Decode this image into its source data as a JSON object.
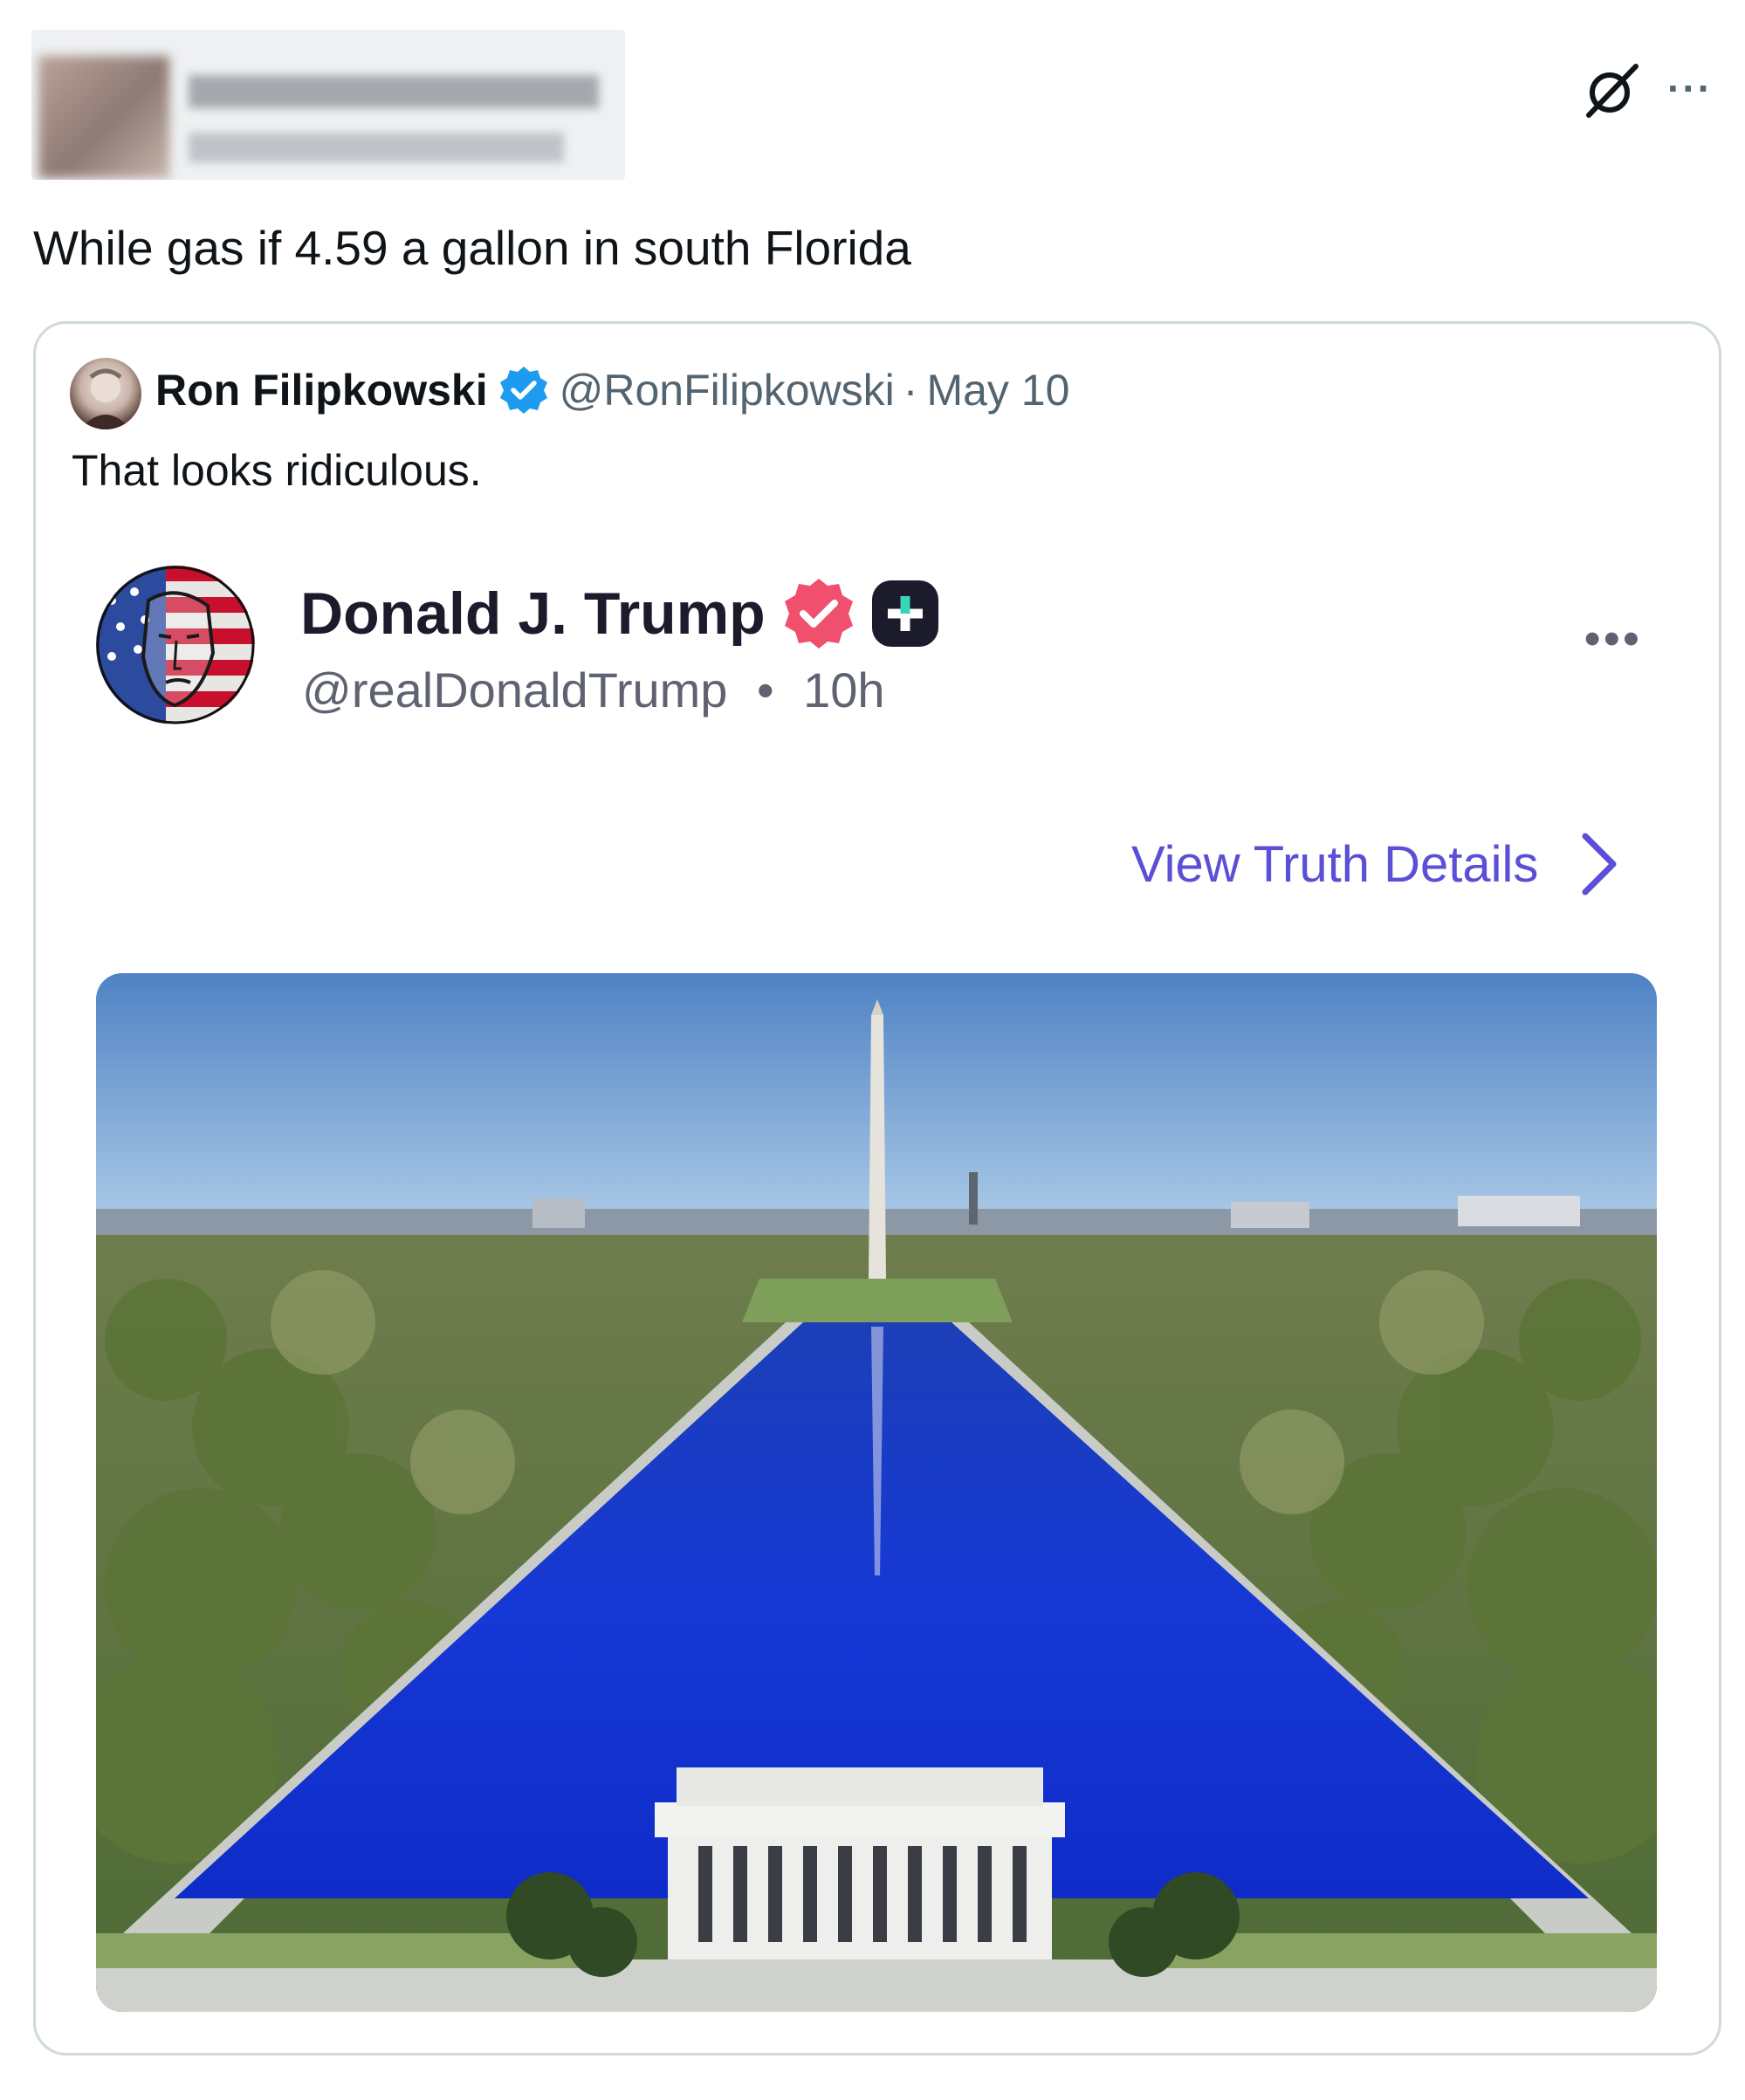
{
  "tweet": {
    "text": "While gas if 4.59 a gallon in south Florida",
    "author_blurred": true,
    "icons": [
      "grok-icon",
      "more-options-icon"
    ]
  },
  "quoted_tweet": {
    "author_name": "Ron Filipkowski",
    "author_handle": "@RonFilipkowski",
    "separator": "·",
    "date": "May 10",
    "verified_color": "#1d9bf0",
    "text": "That looks ridiculous."
  },
  "truth_post": {
    "author_name": "Donald J. Trump",
    "author_handle": "@realDonaldTrump",
    "separator": "•",
    "time": "10h",
    "verified_color": "#f0506e",
    "view_details_label": "View Truth Details",
    "link_color": "#5a4fd6",
    "image": "Lincoln Memorial Reflecting Pool with Washington Monument"
  }
}
